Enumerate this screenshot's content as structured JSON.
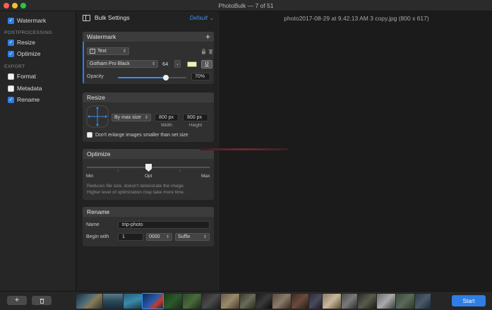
{
  "window": {
    "title": "PhotoBulk — 7 of 51"
  },
  "sidebar": {
    "watermark": {
      "label": "Watermark",
      "checked": true
    },
    "postprocessing_header": "POSTPROCESSING",
    "resize": {
      "label": "Resize",
      "checked": true
    },
    "optimize": {
      "label": "Optimize",
      "checked": true
    },
    "export_header": "EXPORT",
    "format": {
      "label": "Format",
      "checked": false
    },
    "metadata": {
      "label": "Metadata",
      "checked": false
    },
    "rename": {
      "label": "Rename",
      "checked": true
    }
  },
  "settings": {
    "title": "Bulk Settings",
    "preset": "Default",
    "watermark": {
      "title": "Watermark",
      "type": "Text",
      "font": "Gotham Pro Black",
      "size": "64",
      "color": "#f2f2a8",
      "opacity_label": "Opacity",
      "opacity_value": "70%",
      "opacity_fraction": 0.7
    },
    "resize": {
      "title": "Resize",
      "mode": "By max size",
      "width": "800 px",
      "height": "800 px",
      "width_label": "Width",
      "height_label": "Height",
      "no_enlarge_label": "Don't enlarge images smaller than set size",
      "no_enlarge_checked": false
    },
    "optimize": {
      "title": "Optimize",
      "min_label": "Min",
      "opt_label": "Opt",
      "max_label": "Max",
      "slider_fraction": 0.5,
      "desc_line1": "Reduces file size, doesn't deteriorate the image.",
      "desc_line2": "Higher level of optimization may take more time."
    },
    "rename": {
      "title": "Rename",
      "name_label": "Name",
      "name_value": "trip-photo",
      "begin_label": "Begin with",
      "begin_value": "1",
      "digits": "0000",
      "position": "Suffix"
    }
  },
  "preview": {
    "title": "photo2017-08-29 at 9.42.13 AM 3 copy.jpg (800 x 617)"
  },
  "bottom": {
    "add_label": "+",
    "delete_icon": "trash-icon",
    "start_label": "Start",
    "accent": "#2f7ee6"
  }
}
